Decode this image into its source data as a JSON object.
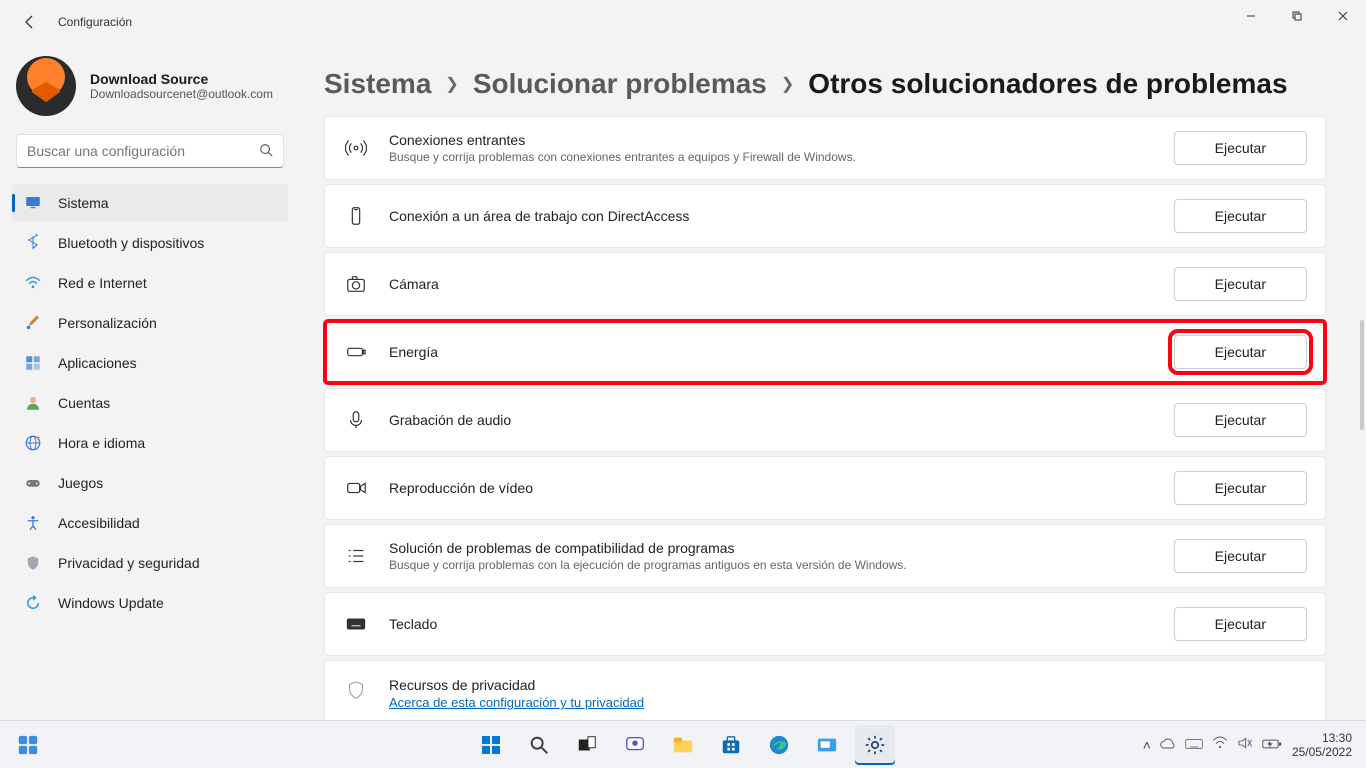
{
  "window": {
    "title": "Configuración"
  },
  "user": {
    "name": "Download Source",
    "email": "Downloadsourcenet@outlook.com"
  },
  "search": {
    "placeholder": "Buscar una configuración"
  },
  "nav": {
    "items": [
      {
        "label": "Sistema",
        "icon": "monitor",
        "active": true
      },
      {
        "label": "Bluetooth y dispositivos",
        "icon": "bluetooth",
        "active": false
      },
      {
        "label": "Red e Internet",
        "icon": "wifi",
        "active": false
      },
      {
        "label": "Personalización",
        "icon": "brush",
        "active": false
      },
      {
        "label": "Aplicaciones",
        "icon": "apps",
        "active": false
      },
      {
        "label": "Cuentas",
        "icon": "person",
        "active": false
      },
      {
        "label": "Hora e idioma",
        "icon": "globe",
        "active": false
      },
      {
        "label": "Juegos",
        "icon": "gamepad",
        "active": false
      },
      {
        "label": "Accesibilidad",
        "icon": "access",
        "active": false
      },
      {
        "label": "Privacidad y seguridad",
        "icon": "shield",
        "active": false
      },
      {
        "label": "Windows Update",
        "icon": "update",
        "active": false
      }
    ]
  },
  "breadcrumb": {
    "a": "Sistema",
    "b": "Solucionar problemas",
    "c": "Otros solucionadores de problemas"
  },
  "btn": {
    "run": "Ejecutar"
  },
  "cards": [
    {
      "title": "Conexiones entrantes",
      "desc": "Busque y corrija problemas con conexiones entrantes a equipos y Firewall de Windows.",
      "icon": "antenna",
      "highlight": false
    },
    {
      "title": "Conexión a un área de trabajo con DirectAccess",
      "desc": "",
      "icon": "phone",
      "highlight": false
    },
    {
      "title": "Cámara",
      "desc": "",
      "icon": "camera",
      "highlight": false
    },
    {
      "title": "Energía",
      "desc": "",
      "icon": "battery",
      "highlight": true
    },
    {
      "title": "Grabación de audio",
      "desc": "",
      "icon": "mic",
      "highlight": false
    },
    {
      "title": "Reproducción de vídeo",
      "desc": "",
      "icon": "video",
      "highlight": false
    },
    {
      "title": "Solución de problemas de compatibilidad de programas",
      "desc": "Busque y corrija problemas con la ejecución de programas antiguos en esta versión de Windows.",
      "icon": "list",
      "highlight": false
    },
    {
      "title": "Teclado",
      "desc": "",
      "icon": "keyboard",
      "highlight": false
    }
  ],
  "privacy": {
    "title": "Recursos de privacidad",
    "link": "Acerca de esta configuración y tu privacidad"
  },
  "clock": {
    "time": "13:30",
    "date": "25/05/2022"
  }
}
